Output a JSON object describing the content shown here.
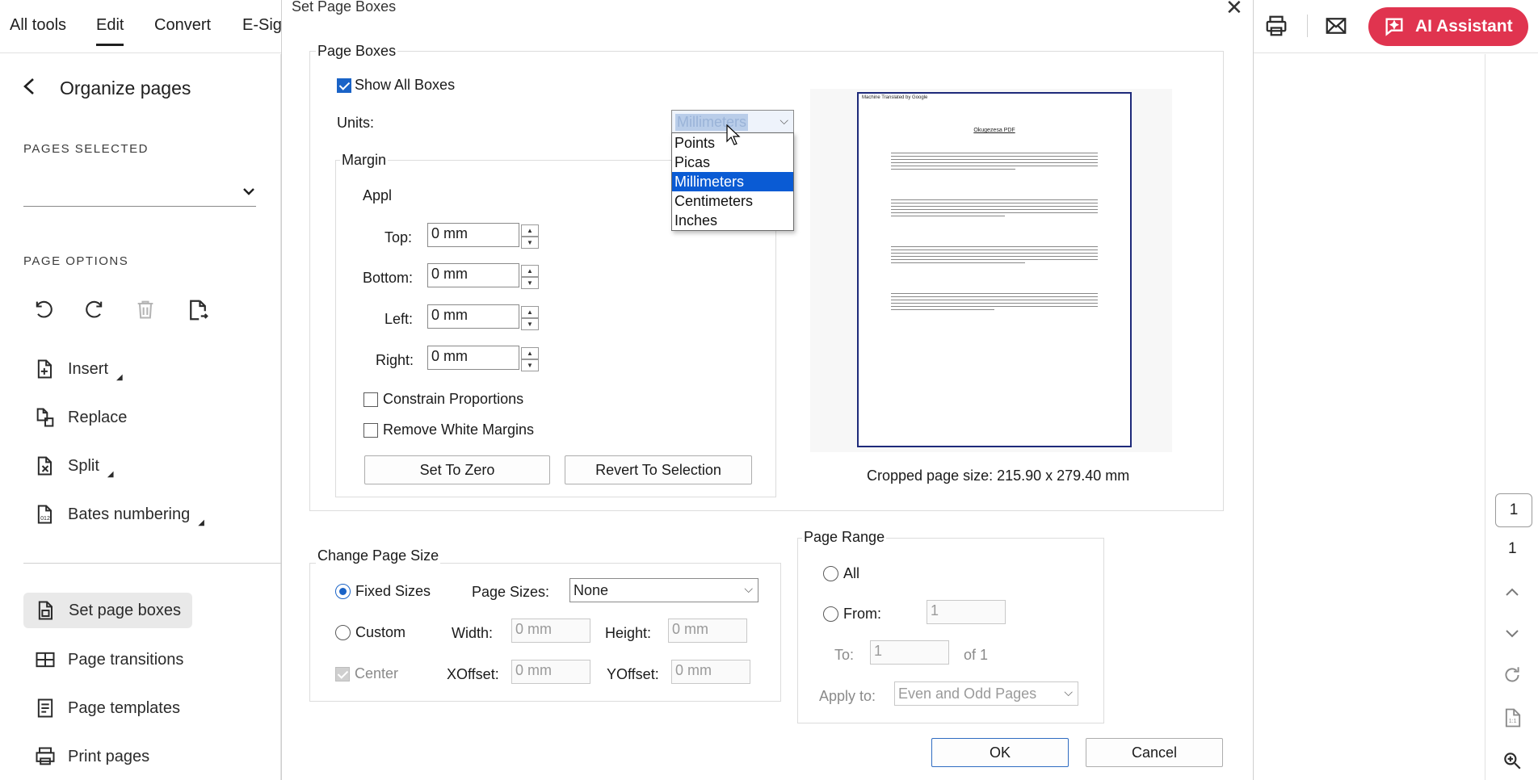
{
  "topbar": {
    "nav": [
      "All tools",
      "Edit",
      "Convert",
      "E-Sig"
    ],
    "active_index": 1,
    "ai_assistant_label": "AI Assistant"
  },
  "left_panel": {
    "back_title": "Organize pages",
    "pages_selected_label": "PAGES SELECTED",
    "page_options_label": "PAGE OPTIONS",
    "tools": [
      {
        "label": "Insert",
        "icon": "insert-page-icon",
        "has_submenu": true
      },
      {
        "label": "Replace",
        "icon": "replace-page-icon",
        "has_submenu": false
      },
      {
        "label": "Split",
        "icon": "split-page-icon",
        "has_submenu": true
      },
      {
        "label": "Bates numbering",
        "icon": "bates-numbering-icon",
        "has_submenu": true
      },
      {
        "label": "Set page boxes",
        "icon": "set-page-boxes-icon",
        "has_submenu": false,
        "selected": true
      },
      {
        "label": "Page transitions",
        "icon": "page-transitions-icon",
        "has_submenu": false
      },
      {
        "label": "Page templates",
        "icon": "page-templates-icon",
        "has_submenu": false
      },
      {
        "label": "Print pages",
        "icon": "print-pages-icon",
        "has_submenu": false
      }
    ]
  },
  "right_rail": {
    "page_box_value": "1",
    "page_total": "1"
  },
  "dialog": {
    "title": "Set Page Boxes",
    "page_boxes": {
      "group_label": "Page Boxes",
      "show_all_boxes_label": "Show All Boxes",
      "show_all_boxes_checked": true,
      "units_label": "Units:",
      "units_value": "Millimeters",
      "units_options": [
        "Points",
        "Picas",
        "Millimeters",
        "Centimeters",
        "Inches"
      ],
      "units_selected_index": 2,
      "margin_label": "Margin",
      "apply_label_partial": "Appl",
      "top_label": "Top:",
      "top_value": "0 mm",
      "bottom_label": "Bottom:",
      "bottom_value": "0 mm",
      "left_label": "Left:",
      "left_value": "0 mm",
      "right_label": "Right:",
      "right_value": "0 mm",
      "constrain_label": "Constrain Proportions",
      "remove_white_label": "Remove White Margins",
      "set_to_zero_label": "Set To Zero",
      "revert_label": "Revert To Selection",
      "cropped_size_text": "Cropped page size: 215.90 x 279.40 mm",
      "preview_header": "Machine Translated by Google",
      "preview_title": "Okugezesa PDF"
    },
    "change_page_size": {
      "group_label": "Change Page Size",
      "fixed_sizes_label": "Fixed Sizes",
      "custom_label": "Custom",
      "center_label": "Center",
      "page_sizes_label": "Page Sizes:",
      "page_sizes_value": "None",
      "width_label": "Width:",
      "width_value": "0 mm",
      "height_label": "Height:",
      "height_value": "0 mm",
      "xoffset_label": "XOffset:",
      "xoffset_value": "0 mm",
      "yoffset_label": "YOffset:",
      "yoffset_value": "0 mm"
    },
    "page_range": {
      "group_label": "Page Range",
      "all_label": "All",
      "from_label": "From:",
      "from_value": "1",
      "to_label": "To:",
      "to_value": "1",
      "of_text": "of 1",
      "apply_to_label": "Apply to:",
      "apply_to_value": "Even and Odd Pages"
    },
    "ok_label": "OK",
    "cancel_label": "Cancel"
  },
  "colors": {
    "accent_blue": "#1a63c7",
    "ai_button": "#e0344f",
    "dropdown_highlight": "#0a5bd4"
  }
}
